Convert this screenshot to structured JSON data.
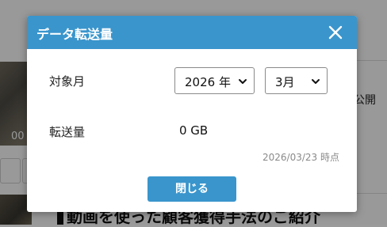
{
  "modal": {
    "title": "データ転送量",
    "month_label": "対象月",
    "year_select_value": "2026 年",
    "month_select_value": "3月",
    "transfer_label": "転送量",
    "transfer_value": "0 GB",
    "timestamp": "2026/03/23 時点",
    "close_button_label": "閉じる",
    "header_color": "#3a95cc"
  },
  "background": {
    "video_time": "00",
    "visibility_label": "公開",
    "video_title": "動画を使った顧客獲得手法のご紹介"
  }
}
